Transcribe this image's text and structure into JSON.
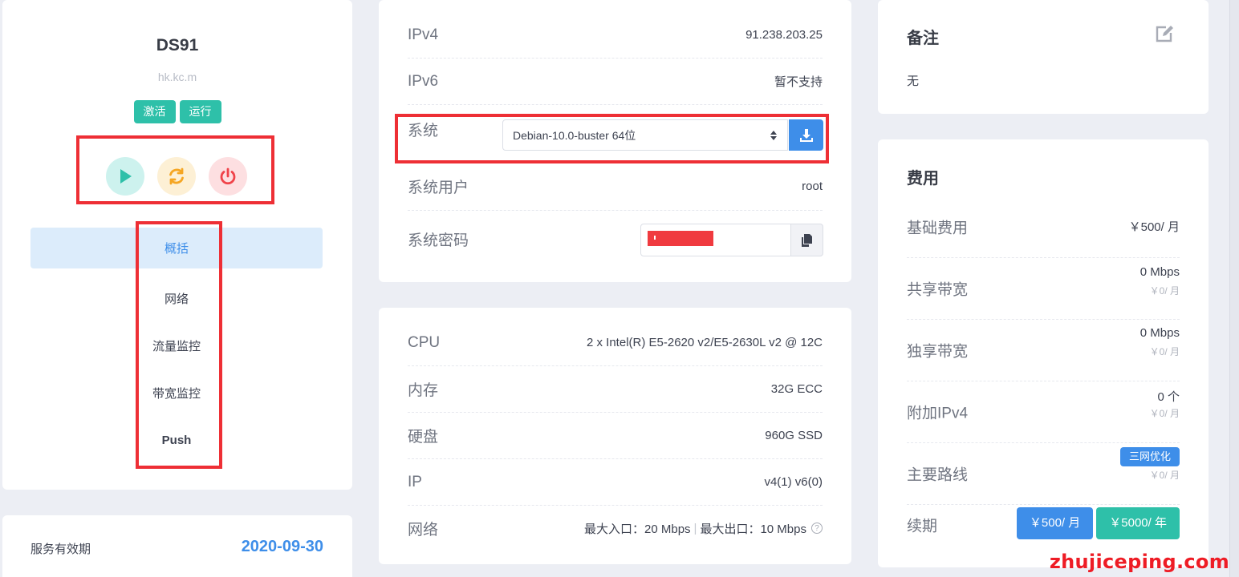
{
  "server": {
    "name": "DS91",
    "host": "hk.kc.m",
    "badges": [
      "激活",
      "运行"
    ]
  },
  "power_buttons": [
    "start",
    "restart",
    "power"
  ],
  "menu": {
    "items": [
      "概括",
      "网络",
      "流量监控",
      "带宽监控",
      "Push"
    ],
    "active": "概括"
  },
  "expire": {
    "label": "服务有效期",
    "date": "2020-09-30"
  },
  "system": {
    "ipv4_label": "IPv4",
    "ipv4": "91.238.203.25",
    "ipv6_label": "IPv6",
    "ipv6": "暂不支持",
    "os_label": "系统",
    "os_selected": "Debian-10.0-buster 64位",
    "user_label": "系统用户",
    "user": "root",
    "password_label": "系统密码"
  },
  "hardware": {
    "cpu_label": "CPU",
    "cpu": "2 x Intel(R) E5-2620 v2/E5-2630L v2 @ 12C",
    "mem_label": "内存",
    "mem": "32G ECC",
    "disk_label": "硬盘",
    "disk": "960G SSD",
    "ip_label": "IP",
    "ip": "v4(1) v6(0)",
    "net_label": "网络",
    "net_in": "最大入口：20 Mbps",
    "net_out": "最大出口：10 Mbps"
  },
  "note": {
    "title": "备注",
    "text": "无"
  },
  "fee": {
    "title": "费用",
    "base_label": "基础费用",
    "base": "￥500/ 月",
    "shared_label": "共享带宽",
    "shared": "0 Mbps",
    "shared_price": "￥0/ 月",
    "dedicated_label": "独享带宽",
    "dedicated": "0 Mbps",
    "dedicated_price": "￥0/ 月",
    "extra_ip_label": "附加IPv4",
    "extra_ip": "0 个",
    "extra_ip_price": "￥0/ 月",
    "route_label": "主要路线",
    "route": "三网优化",
    "route_price": "￥0/ 月",
    "renew_label": "续期",
    "renew_month": "￥500/ 月",
    "renew_year": "￥5000/ 年"
  },
  "watermark": "zhujiceping.com",
  "colors": {
    "primary": "#3e8ee9",
    "teal": "#2ec0a9",
    "highlight": "#ee2f35"
  }
}
